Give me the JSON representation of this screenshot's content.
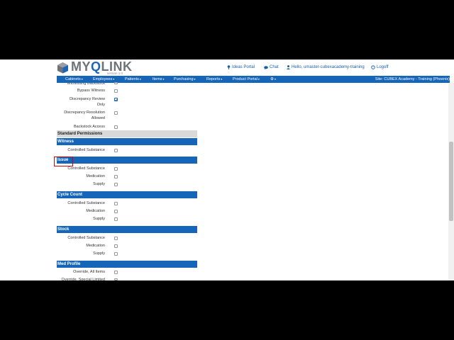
{
  "header": {
    "logo_prefix": "MY",
    "logo_q": "Q",
    "logo_suffix": "LINK",
    "version": "version 1.0",
    "ideas_portal": "Ideas Portal",
    "chat": "Chat",
    "hello": "Hello, umaster-cubexacademy-training",
    "logoff": "Logoff"
  },
  "nav": {
    "items": [
      "Cabinets",
      "Employees",
      "Patients",
      "Items",
      "Purchasing",
      "Reports",
      "Product Portal"
    ],
    "site": "Site: CUBEX Academy - Training (Phoenix)"
  },
  "top_rows": {
    "partial": "Witnessing Backstock",
    "bypass_witness": "Bypass Witness",
    "discrepancy_review_l1": "Discrepancy Review",
    "discrepancy_review_l2": "Only",
    "discrepancy_resolution_l1": "Discrepancy Resolution",
    "discrepancy_resolution_l2": "Allowed",
    "backstock_access": "Backstock Access"
  },
  "standard_permissions": "Standard Permissions",
  "sections": {
    "witness": "Witness",
    "issue": "Issue",
    "cycle_count": "Cycle Count",
    "stock": "Stock",
    "med_profile": "Med Profile"
  },
  "labels": {
    "controlled_substance": "Controlled Substance",
    "medication": "Medication",
    "supply": "Supply",
    "override_all_items": "Override, All Items",
    "override_partial": "Override, Special Limited"
  },
  "checkboxes": {
    "discrepancy_review_only": true
  },
  "colors": {
    "nav_blue": "#1565b8",
    "highlight_red": "#d60000"
  }
}
